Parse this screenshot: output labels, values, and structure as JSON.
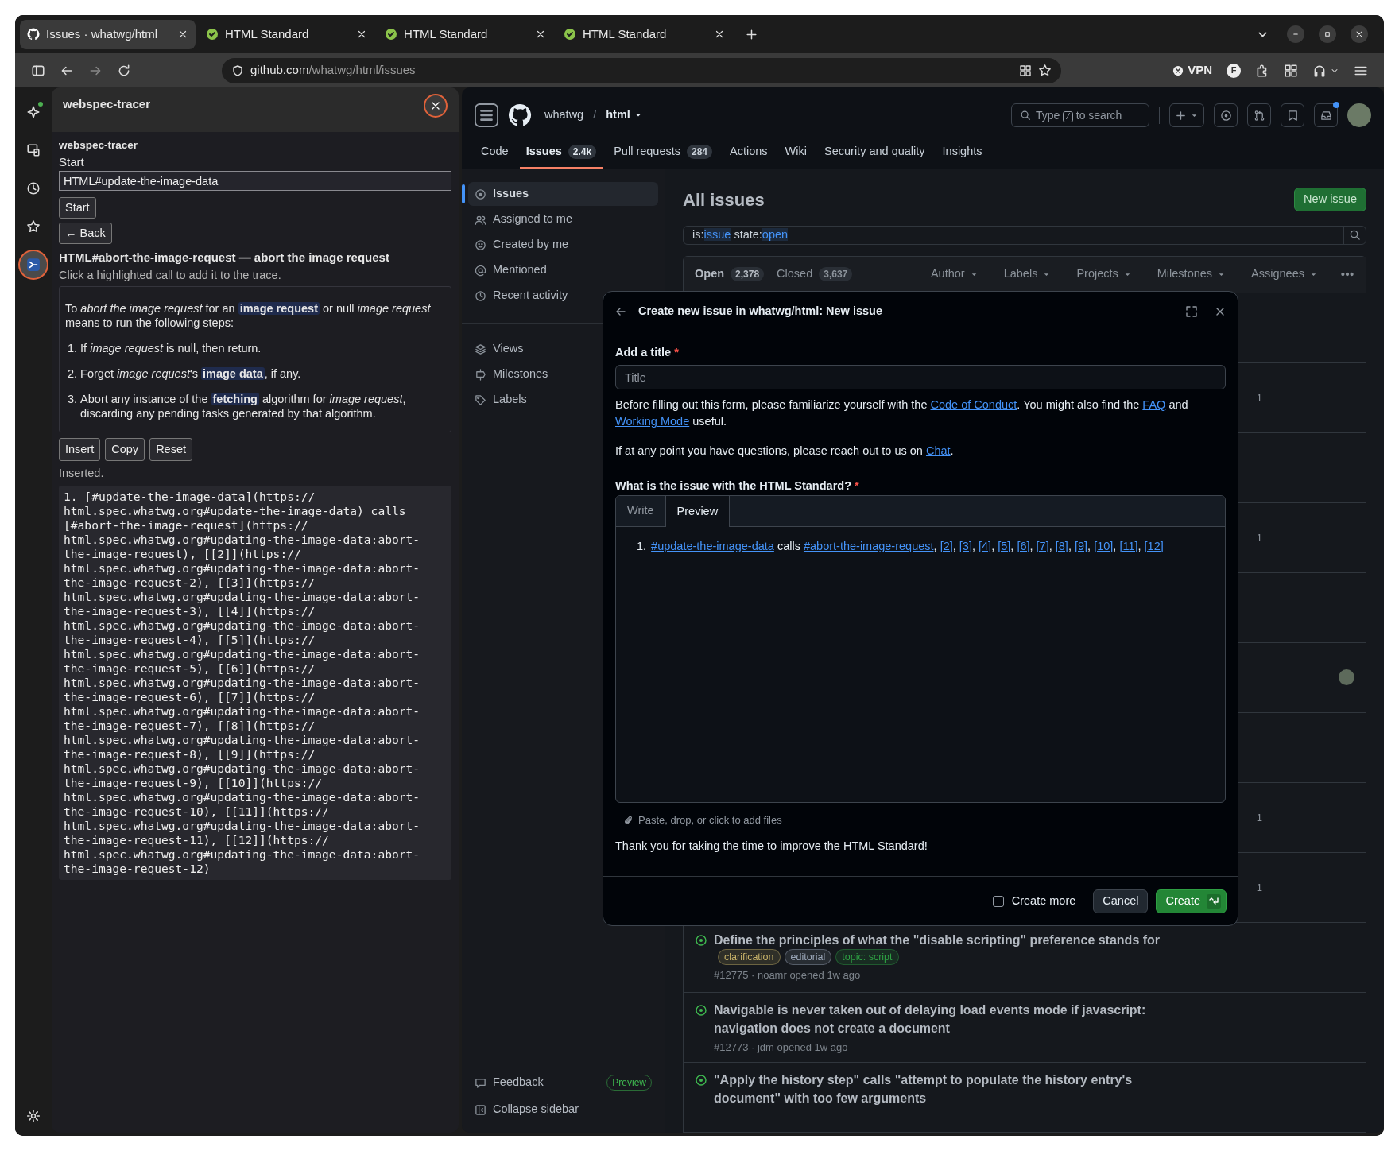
{
  "browser": {
    "tabs": [
      {
        "title": "Issues · whatwg/html",
        "selected": true
      },
      {
        "title": "HTML Standard",
        "selected": false
      },
      {
        "title": "HTML Standard",
        "selected": false
      },
      {
        "title": "HTML Standard",
        "selected": false
      }
    ],
    "url_host": "github.com",
    "url_path": "/whatwg/html/issues",
    "vpn_label": "VPN",
    "profile_letter": "F"
  },
  "extension_rail": [
    {
      "kind": "sparkle",
      "badge": true,
      "selected": false
    },
    {
      "kind": "devices",
      "badge": false,
      "selected": false
    },
    {
      "kind": "history",
      "badge": false,
      "selected": false
    },
    {
      "kind": "star",
      "badge": false,
      "selected": false
    },
    {
      "kind": "tracer",
      "badge": false,
      "selected": true
    }
  ],
  "panel": {
    "title": "webspec-tracer",
    "heading": "webspec-tracer",
    "start_label": "Start",
    "start_value": "HTML#update-the-image-data",
    "start_button": "Start",
    "back_button": "← Back",
    "section_title": "HTML#abort-the-image-request — abort the image request",
    "hint": "Click a highlighted call to add it to the trace.",
    "intro": "To *abort the image request* for an **image request** or null *image request* means to run the following steps:",
    "steps": [
      {
        "number": "1.",
        "text": "If *image request* is null, then return."
      },
      {
        "number": "2.",
        "text": "Forget *image request*'s **image data**, if any."
      },
      {
        "number": "3.",
        "text": "Abort any instance of the **fetching** algorithm for *image request*, discarding any pending tasks generated by that algorithm."
      }
    ],
    "actions": [
      "Insert",
      "Copy",
      "Reset"
    ],
    "status": "Inserted.",
    "output": "1. [#update-the-image-data](https://html.spec.whatwg.org#update-the-image-data) calls [#abort-the-image-request](https://html.spec.whatwg.org#updating-the-image-data:abort-the-image-request), [[2]](https://html.spec.whatwg.org#updating-the-image-data:abort-the-image-request-2), [[3]](https://html.spec.whatwg.org#updating-the-image-data:abort-the-image-request-3), [[4]](https://html.spec.whatwg.org#updating-the-image-data:abort-the-image-request-4), [[5]](https://html.spec.whatwg.org#updating-the-image-data:abort-the-image-request-5), [[6]](https://html.spec.whatwg.org#updating-the-image-data:abort-the-image-request-6), [[7]](https://html.spec.whatwg.org#updating-the-image-data:abort-the-image-request-7), [[8]](https://html.spec.whatwg.org#updating-the-image-data:abort-the-image-request-8), [[9]](https://html.spec.whatwg.org#updating-the-image-data:abort-the-image-request-9), [[10]](https://html.spec.whatwg.org#updating-the-image-data:abort-the-image-request-10), [[11]](https://html.spec.whatwg.org#updating-the-image-data:abort-the-image-request-11), [[12]](https://html.spec.whatwg.org#updating-the-image-data:abort-the-image-request-12)"
  },
  "github": {
    "owner": "whatwg",
    "separator": "/",
    "repo": "html",
    "search": {
      "before": "Type",
      "key": "/",
      "after": "to search"
    },
    "nav_tabs": [
      {
        "label": "Code",
        "selected": false
      },
      {
        "label": "Issues",
        "count": "2.4k",
        "selected": true
      },
      {
        "label": "Pull requests",
        "count": "284",
        "selected": false
      },
      {
        "label": "Actions",
        "selected": false
      },
      {
        "label": "Wiki",
        "selected": false
      },
      {
        "label": "Security and quality",
        "selected": false
      },
      {
        "label": "Insights",
        "selected": false
      }
    ],
    "sidebar": {
      "groups": [
        [
          {
            "label": "Issues",
            "selected": true
          },
          {
            "label": "Assigned to me",
            "selected": false
          },
          {
            "label": "Created by me",
            "selected": false
          },
          {
            "label": "Mentioned",
            "selected": false
          },
          {
            "label": "Recent activity",
            "selected": false
          }
        ],
        [
          {
            "label": "Views",
            "selected": false
          },
          {
            "label": "Milestones",
            "selected": false
          },
          {
            "label": "Labels",
            "selected": false
          }
        ]
      ],
      "feedback": "Feedback",
      "feedback_badge": "Preview",
      "collapse": "Collapse sidebar"
    },
    "title": "All issues",
    "new_issue": "New issue",
    "query": [
      {
        "key": "is:",
        "value": "issue"
      },
      {
        "key": "state:",
        "value": "open"
      }
    ],
    "state_tabs": [
      {
        "label": "Open",
        "count": "2,378",
        "selected": true
      },
      {
        "label": "Closed",
        "count": "3,637",
        "selected": false
      }
    ],
    "filters": [
      "Author",
      "Labels",
      "Projects",
      "Milestones",
      "Assignees"
    ],
    "covered_rows": [
      {
        "avatar": false
      },
      {
        "avatar": false,
        "comment_count": "1"
      },
      {
        "avatar": false
      },
      {
        "avatar": false,
        "comment_count": "1"
      },
      {
        "avatar": false
      },
      {
        "avatar": true
      },
      {
        "avatar": false
      },
      {
        "avatar": false,
        "comment_count": "1"
      },
      {
        "avatar": false,
        "comment_count": "1"
      }
    ],
    "issues": [
      {
        "title": "Define the principles of what the \"disable scripting\" preference stands for",
        "labels": [
          {
            "name": "clarification",
            "color": "#c9b46a"
          },
          {
            "name": "editorial",
            "color": "#9aa6b8"
          },
          {
            "name": "topic: script",
            "color": "#2ea043"
          }
        ],
        "meta": "#12775 · noamr opened 1w ago"
      },
      {
        "title": "Navigable is never taken out of delaying load events mode if javascript: navigation does not create a document",
        "meta": "#12773 · jdm opened 1w ago"
      },
      {
        "title": "\"Apply the history step\" calls \"attempt to populate the history entry's document\" with too few arguments"
      }
    ]
  },
  "dialog": {
    "title": "Create new issue in whatwg/html: New issue",
    "title_label": "Add a title",
    "required_mark": "*",
    "title_placeholder": "Title",
    "notice": [
      {
        "text": "Before filling out this form, please familiarize yourself with the "
      },
      {
        "text": "Code of Conduct",
        "link": true
      },
      {
        "text": ". You might also find the "
      },
      {
        "text": "FAQ",
        "link": true
      },
      {
        "text": " and "
      },
      {
        "text": "Working Mode",
        "link": true
      },
      {
        "text": " useful."
      }
    ],
    "contact": [
      {
        "text": "If at any point you have questions, please reach out to us on "
      },
      {
        "text": "Chat",
        "link": true
      },
      {
        "text": "."
      }
    ],
    "question": "What is the issue with the HTML Standard?",
    "question_required": "*",
    "editor_tabs": [
      {
        "label": "Write",
        "selected": false
      },
      {
        "label": "Preview",
        "selected": true
      }
    ],
    "preview_number": "1.",
    "preview": [
      {
        "text": "#update-the-image-data",
        "link": true
      },
      {
        "text": " calls "
      },
      {
        "text": "#abort-the-image-request",
        "link": true
      },
      {
        "text": ", "
      },
      {
        "text": "[2]",
        "link": true
      },
      {
        "text": ", "
      },
      {
        "text": "[3]",
        "link": true
      },
      {
        "text": ", "
      },
      {
        "text": "[4]",
        "link": true
      },
      {
        "text": ", "
      },
      {
        "text": "[5]",
        "link": true
      },
      {
        "text": ", "
      },
      {
        "text": "[6]",
        "link": true
      },
      {
        "text": ", "
      },
      {
        "text": "[7]",
        "link": true
      },
      {
        "text": ", "
      },
      {
        "text": "[8]",
        "link": true
      },
      {
        "text": ", "
      },
      {
        "text": "[9]",
        "link": true
      },
      {
        "text": ", "
      },
      {
        "text": "[10]",
        "link": true
      },
      {
        "text": ", "
      },
      {
        "text": "[11]",
        "link": true
      },
      {
        "text": ", "
      },
      {
        "text": "[12]",
        "link": true
      }
    ],
    "attach_hint": "Paste, drop, or click to add files",
    "thanks": "Thank you for taking the time to improve the HTML Standard!",
    "create_more": {
      "label": "Create more",
      "checked": false
    },
    "cancel": "Cancel",
    "create": "Create"
  }
}
